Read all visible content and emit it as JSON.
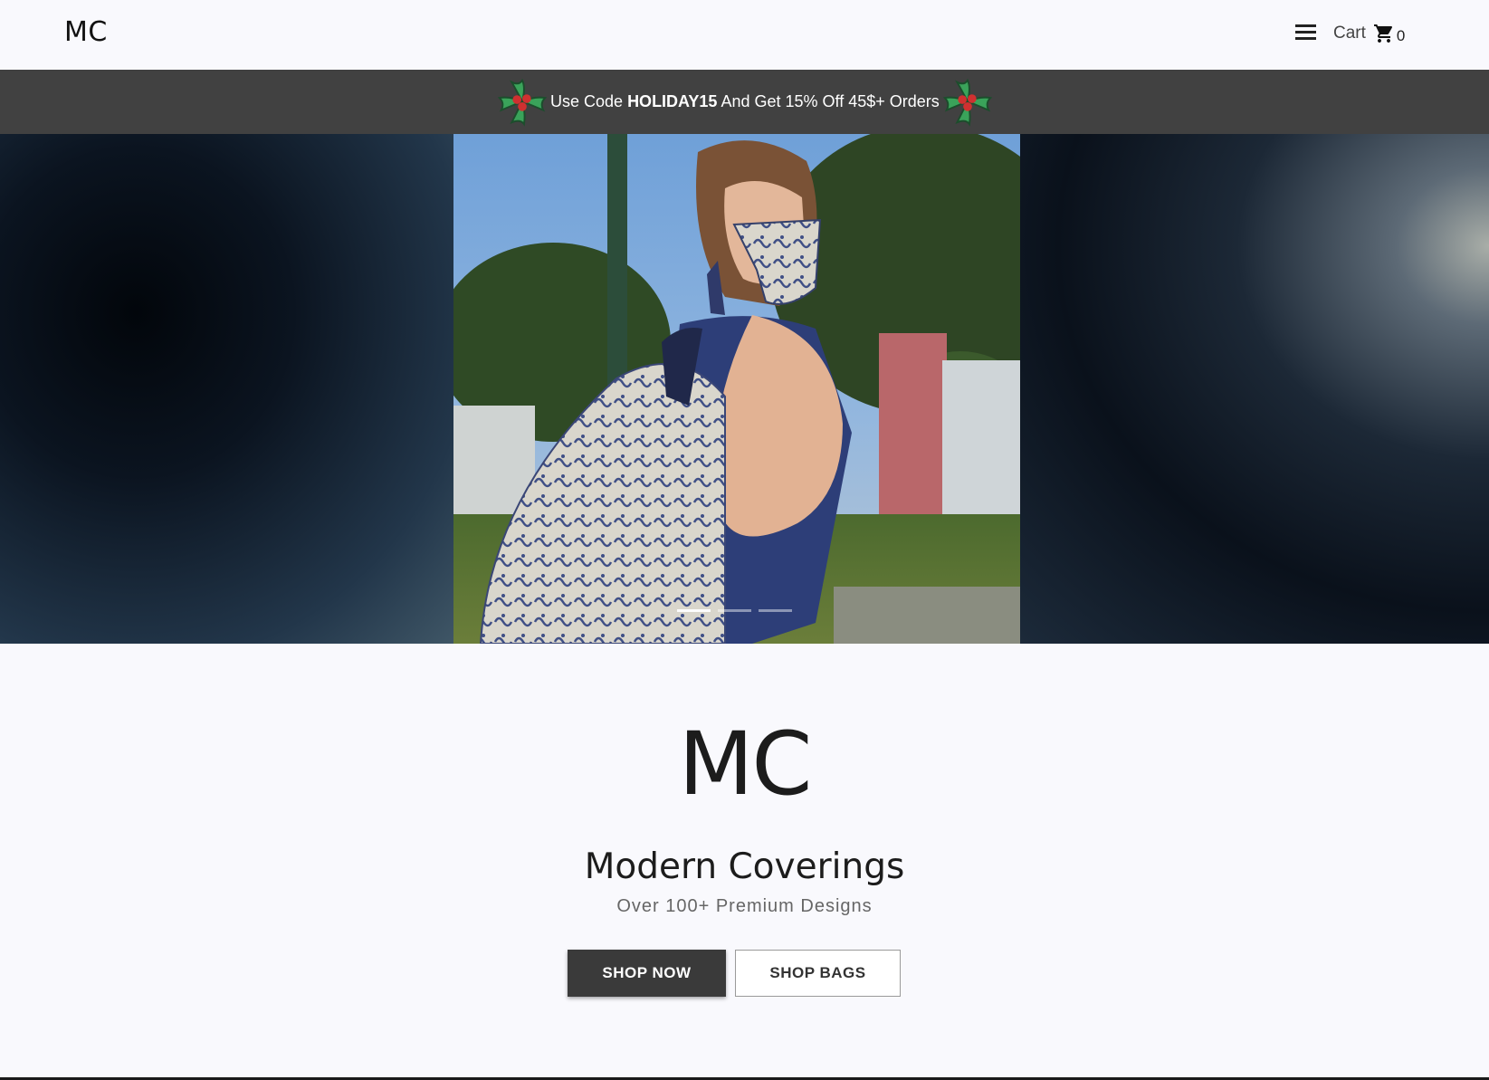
{
  "header": {
    "logo": "MC",
    "menu_icon": "hamburger-menu-icon",
    "cart_label": "Cart",
    "cart_icon": "shopping-cart-icon",
    "cart_count": "0"
  },
  "promo": {
    "prefix": "Use Code",
    "code": "HOLIDAY15",
    "suffix": "And Get 15% Off 45$+ Orders",
    "icon": "holly-icon",
    "background": "#414141"
  },
  "carousel": {
    "slides": 3,
    "active_index": 0,
    "image_description_icon": "hero-photo"
  },
  "main": {
    "brand_mark": "MC",
    "title": "Modern Coverings",
    "subtitle": "Over 100+ Premium Designs",
    "primary_button": "SHOP NOW",
    "secondary_button": "SHOP BAGS",
    "primary_color": "#3a3a3a"
  }
}
